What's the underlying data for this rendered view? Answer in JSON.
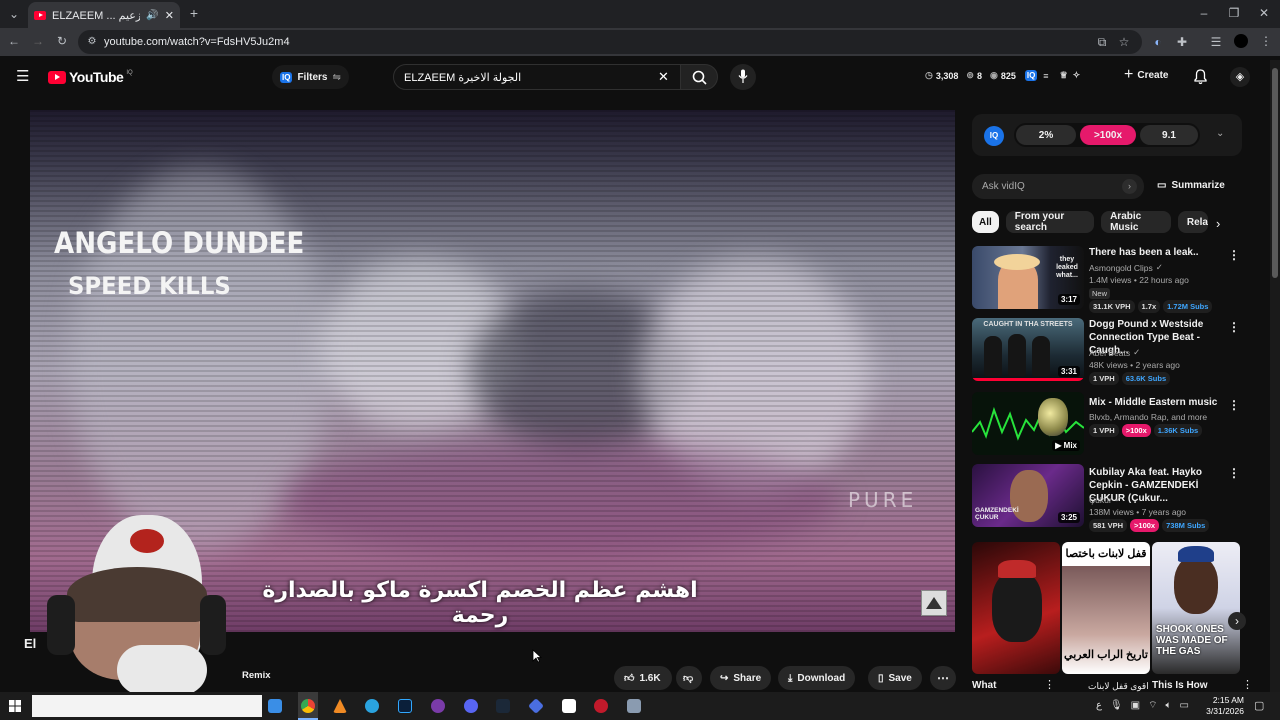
{
  "browser": {
    "tab_title": "ELZAEEM ... الجولة الأخيرة .. الزعيم",
    "url": "youtube.com/watch?v=FdsHV5Ju2m4"
  },
  "header": {
    "logo_text": "YouTube",
    "logo_badge": "IQ",
    "filters_label": "Filters",
    "search_value": "ELZAEEM الجولة الاخيرة",
    "stats": {
      "views": "3,308",
      "likes": "8",
      "subs": "825"
    },
    "create_label": "Create"
  },
  "vidiq": {
    "badge": "IQ",
    "metric1": "2%",
    "metric2": ">100x",
    "metric3": "9.1",
    "ask_placeholder": "Ask vidIQ",
    "summarize_label": "Summarize"
  },
  "chips": [
    "All",
    "From your search",
    "Arabic Music",
    "Rela"
  ],
  "video": {
    "overlay_line1": "ANGELO DUNDEE",
    "overlay_line2": "SPEED KILLS",
    "watermark": "PURE",
    "subtitle": "اهشم عظم الخصم اكسرة ماكو بالصدارة رحمة",
    "channel_initial": "El",
    "remix_label": "Remix"
  },
  "actions": {
    "like_count": "1.6K",
    "share_label": "Share",
    "download_label": "Download",
    "save_label": "Save"
  },
  "recommendations": [
    {
      "title": "There has been a leak..",
      "channel": "Asmongold Clips",
      "meta": "1.4M views • 22 hours ago",
      "badge": "New",
      "duration": "3:17",
      "thumb_text": "they leaked what...",
      "stats": [
        "31.1K VPH",
        "1.7x",
        "1.72M Subs"
      ]
    },
    {
      "title": "Dogg Pound x Westside Connection Type Beat - Caugh...",
      "channel": "Abel Beats",
      "meta": "48K views • 2 years ago",
      "duration": "3:31",
      "thumb_text": "CAUGHT IN THA STREETS",
      "stats": [
        "1 VPH",
        "63.6K Subs"
      ]
    },
    {
      "title": "Mix - Middle Eastern music",
      "channel": "Blvxb, Armando Rap, and more",
      "meta": "",
      "duration": "Mix",
      "stats": [
        "1 VPH",
        ">100x",
        "1.36K Subs"
      ]
    },
    {
      "title": "Kubilay Aka feat. Hayko Cepkin - GAMZENDEKİ ÇUKUR (Çukur...",
      "channel": "Çukur",
      "meta": "138M views • 7 years ago",
      "duration": "3:25",
      "thumb_text": "GAMZENDEKİ ÇUKUR",
      "stats": [
        "581 VPH",
        ">100x",
        "738M Subs"
      ]
    }
  ],
  "shorts": [
    {
      "title": "What",
      "thumb_text": ""
    },
    {
      "title": "اقوى قفل لابنات",
      "thumb_text_top": "قفل لابنات باختصا",
      "thumb_text_bottom": "تاريخ الراب العربي"
    },
    {
      "title": "This Is How",
      "thumb_text": "SHOOK ONES WAS MADE OF THE GAS"
    }
  ],
  "taskbar": {
    "time": "2:15 AM",
    "date": "3/31/2026",
    "lang": "ع"
  },
  "colors": {
    "youtube_red": "#ff0033",
    "vidiq_blue": "#1a73e8",
    "vidiq_pink": "#e6196b",
    "subs_blue": "#3ea6ff"
  }
}
